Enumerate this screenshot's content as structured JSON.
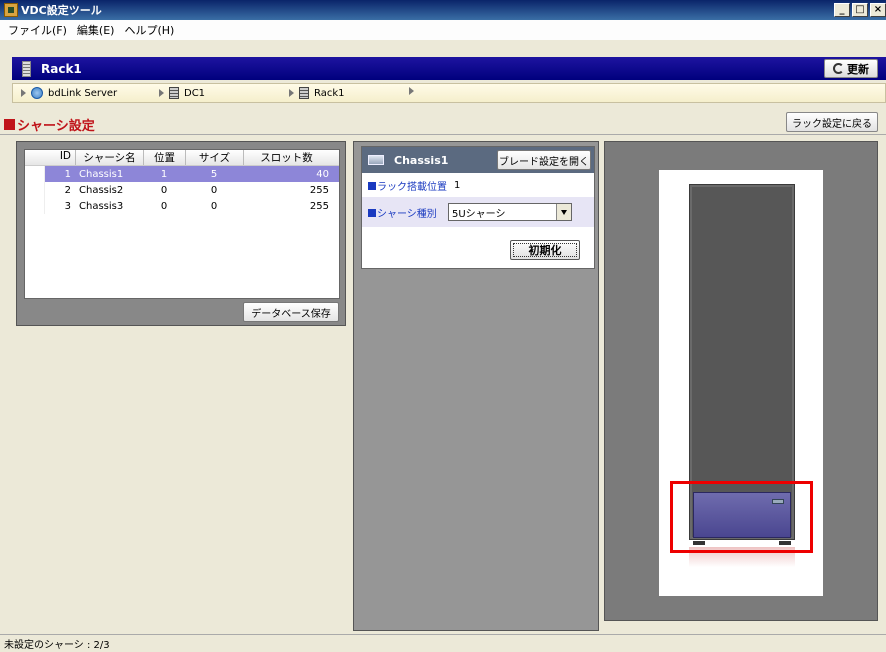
{
  "window": {
    "title": "VDC設定ツール",
    "min": "_",
    "max": "□",
    "close": "×"
  },
  "menu": [
    "ファイル(F)",
    "編集(E)",
    "ヘルプ(H)"
  ],
  "rack": {
    "name": "Rack1",
    "refresh_label": "更新"
  },
  "breadcrumb": [
    "bdLink Server",
    "DC1",
    "Rack1"
  ],
  "section": {
    "title": "シャーシ設定",
    "back_label": "ラック設定に戻る"
  },
  "grid": {
    "headers": {
      "id": "ID",
      "name": "シャーシ名",
      "pos": "位置",
      "size": "サイズ",
      "slots": "スロット数"
    },
    "rows": [
      {
        "id": "1",
        "name": "Chassis1",
        "pos": "1",
        "size": "5",
        "slots": "40"
      },
      {
        "id": "2",
        "name": "Chassis2",
        "pos": "0",
        "size": "0",
        "slots": "255"
      },
      {
        "id": "3",
        "name": "Chassis3",
        "pos": "0",
        "size": "0",
        "slots": "255"
      }
    ],
    "save_label": "データベース保存"
  },
  "detail": {
    "name": "Chassis1",
    "blade_label": "ブレード設定を開く",
    "pos_label": "ラック搭載位置",
    "pos_value": "1",
    "type_label": "シャーシ種別",
    "type_value": "5Uシャーシ",
    "init_label": "初期化"
  },
  "status": {
    "text": "未設定のシャーシ : 2/3"
  },
  "colors": {
    "accent_red": "#c0141a",
    "rack_bar": "#00007d",
    "selected_row": "#8d86d8",
    "label_blue": "#1a3ac0"
  }
}
